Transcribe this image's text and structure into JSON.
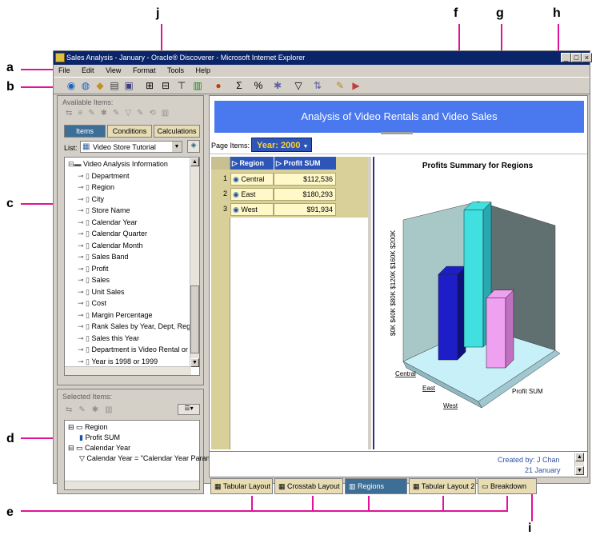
{
  "callouts": [
    "a",
    "b",
    "c",
    "d",
    "e",
    "f",
    "g",
    "h",
    "i",
    "j"
  ],
  "window": {
    "title": "Sales Analysis - January - Oracle® Discoverer - Microsoft Internet Explorer"
  },
  "menu": [
    "File",
    "Edit",
    "View",
    "Format",
    "Tools",
    "Help"
  ],
  "available": {
    "title": "Available Items:",
    "tabs": [
      "Items",
      "Conditions",
      "Calculations"
    ],
    "list_label": "List:",
    "list_value": "Video Store Tutorial",
    "tree": [
      {
        "label": "Video Analysis Information",
        "indent": 0
      },
      {
        "label": "Department",
        "indent": 1
      },
      {
        "label": "Region",
        "indent": 1
      },
      {
        "label": "City",
        "indent": 1
      },
      {
        "label": "Store Name",
        "indent": 1
      },
      {
        "label": "Calendar Year",
        "indent": 1
      },
      {
        "label": "Calendar Quarter",
        "indent": 1
      },
      {
        "label": "Calendar Month",
        "indent": 1
      },
      {
        "label": "Sales Band",
        "indent": 1
      },
      {
        "label": "Profit",
        "indent": 1
      },
      {
        "label": "Sales",
        "indent": 1
      },
      {
        "label": "Unit Sales",
        "indent": 1
      },
      {
        "label": "Cost",
        "indent": 1
      },
      {
        "label": "Margin Percentage",
        "indent": 1
      },
      {
        "label": "Rank Sales by Year, Dept, Reg",
        "indent": 1
      },
      {
        "label": "Sales this Year",
        "indent": 1
      },
      {
        "label": "Department is Video Rental or",
        "indent": 1
      },
      {
        "label": "Year is 1998 or 1999",
        "indent": 1
      }
    ]
  },
  "selected": {
    "title": "Selected Items:",
    "tree": [
      "Region",
      "Profit SUM",
      "Calendar Year",
      "Calendar Year = \"Calendar Year Parameter\""
    ]
  },
  "report": {
    "title": "Analysis of Video Rentals and Video Sales",
    "page_items_label": "Page Items:",
    "page_item_value": "Year: 2000",
    "columns": [
      "Region",
      "Profit SUM"
    ],
    "rows": [
      {
        "num": "1",
        "region": "Central",
        "profit": "$112,536"
      },
      {
        "num": "2",
        "region": "East",
        "profit": "$180,293"
      },
      {
        "num": "3",
        "region": "West",
        "profit": "$91,934"
      }
    ],
    "footer_line1": "Created by: J Chan",
    "footer_line2": "21 January"
  },
  "chart": {
    "title": "Profits Summary for Regions",
    "axis_label": "$0K $40K $80K $120K $160K $200K",
    "category_labels": [
      "Central",
      "East",
      "West"
    ],
    "series_label": "Profit SUM",
    "colors": {
      "central": "#1e1ec8",
      "east": "#40e0e0",
      "west": "#f0a0f0"
    }
  },
  "chart_data": {
    "type": "bar",
    "title": "Profits Summary for Regions",
    "categories": [
      "Central",
      "East",
      "West"
    ],
    "series": [
      {
        "name": "Profit SUM",
        "values": [
          112536,
          180293,
          91934
        ]
      }
    ],
    "ylim": [
      0,
      200000
    ]
  },
  "worksheet_tabs": [
    "Tabular Layout",
    "Crosstab Layout",
    "Regions",
    "Tabular Layout 2",
    "Breakdown"
  ]
}
